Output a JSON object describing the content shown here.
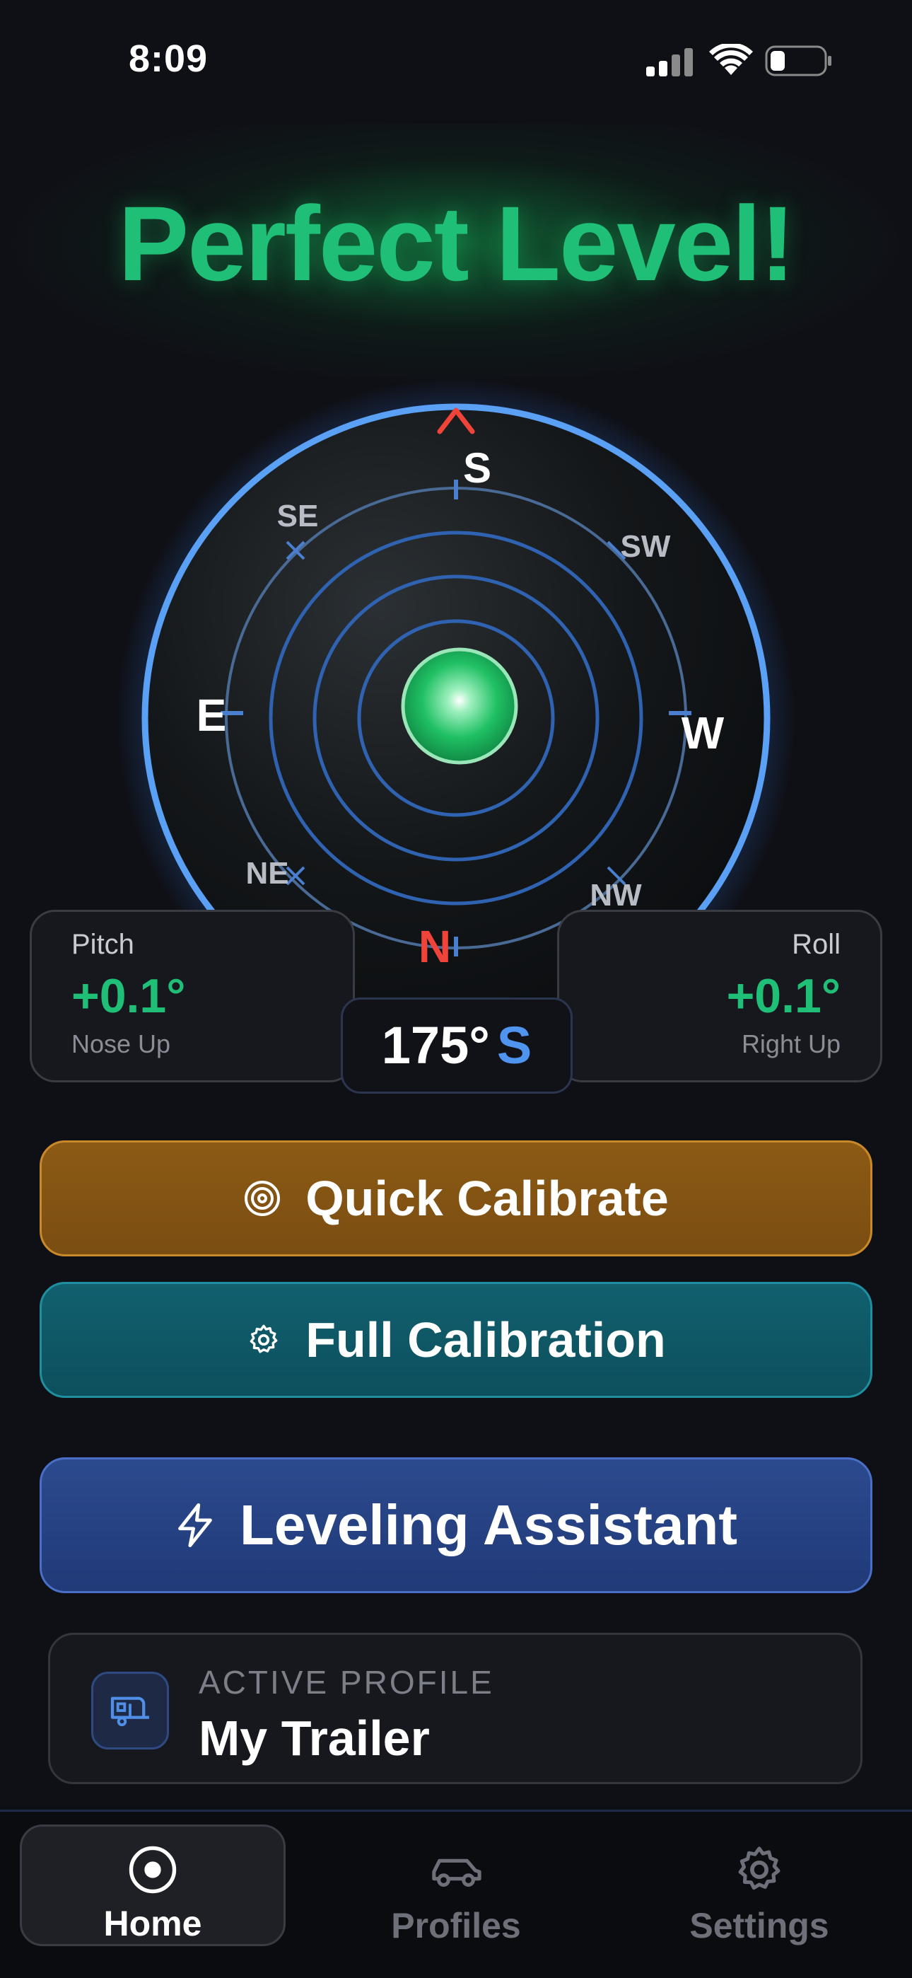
{
  "status_bar": {
    "time": "8:09",
    "icons": [
      "signal-icon",
      "wifi-icon",
      "battery-icon"
    ]
  },
  "headline": "Perfect Level!",
  "compass": {
    "directions": {
      "s": "S",
      "sw": "SW",
      "w": "W",
      "nw": "NW",
      "n": "N",
      "ne": "NE",
      "e": "E",
      "se": "SE"
    },
    "pointer_icon": "chevron-up-icon",
    "colors": {
      "ring": "#5aa0f5",
      "inner_rings": "#2f5fae",
      "bubble": "#22c867",
      "north": "#f0443a",
      "pointer": "#f0443a"
    }
  },
  "pitch": {
    "label": "Pitch",
    "value": "+0.1°",
    "sub": "Nose Up"
  },
  "roll": {
    "label": "Roll",
    "value": "+0.1°",
    "sub": "Right Up"
  },
  "heading": {
    "degrees": "175°",
    "direction": "S"
  },
  "buttons": {
    "quick_calibrate": {
      "label": "Quick Calibrate",
      "icon": "target-icon",
      "color": "#8c5a14"
    },
    "full_calibration": {
      "label": "Full Calibration",
      "icon": "gear-icon",
      "color": "#11606f"
    },
    "leveling_assistant": {
      "label": "Leveling Assistant",
      "icon": "lightning-icon",
      "color": "#2b4a8e"
    }
  },
  "active_profile": {
    "caption": "ACTIVE PROFILE",
    "name": "My Trailer",
    "icon": "trailer-icon"
  },
  "tabs": [
    {
      "label": "Home",
      "icon": "home-target-icon",
      "active": true
    },
    {
      "label": "Profiles",
      "icon": "car-icon",
      "active": false
    },
    {
      "label": "Settings",
      "icon": "gear-icon",
      "active": false
    }
  ],
  "accent_colors": {
    "level_green": "#1fbf77",
    "heading_blue": "#4f95f0"
  }
}
